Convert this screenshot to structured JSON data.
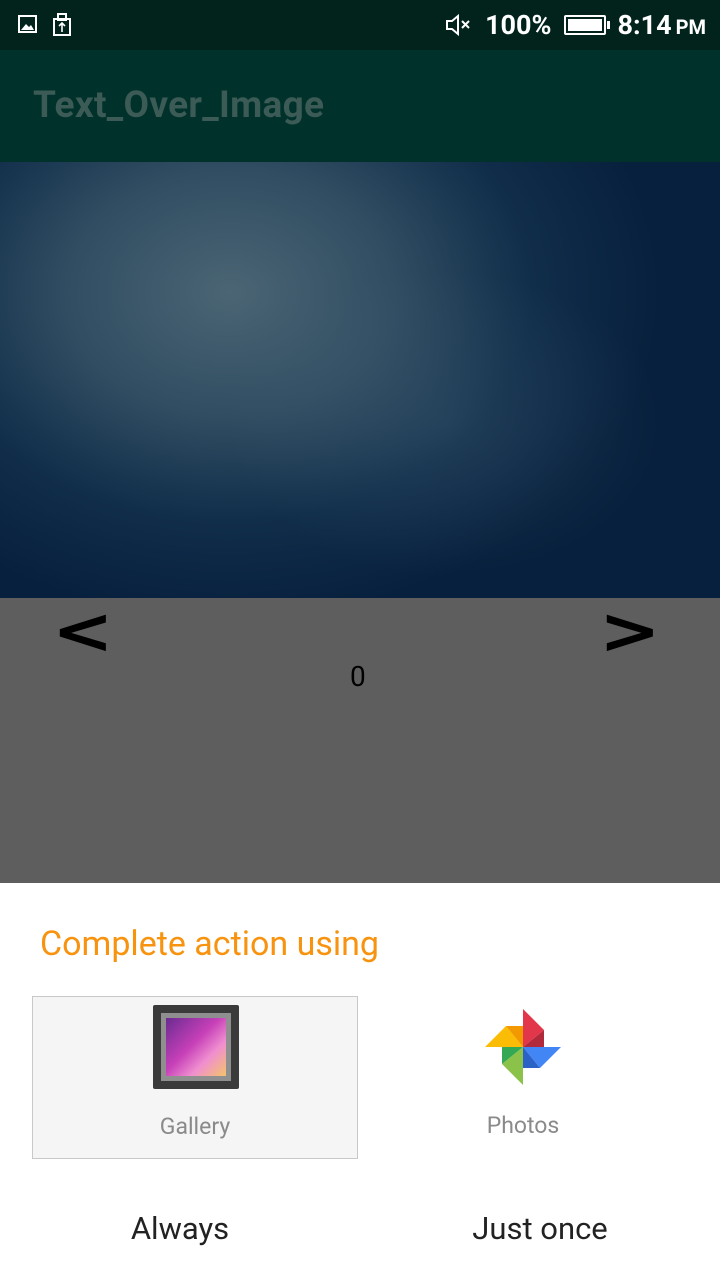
{
  "status_bar": {
    "left_icons": [
      "image-icon",
      "usb-icon"
    ],
    "mute_icon": "mute-icon",
    "battery_percent": "100%",
    "time": "8:14",
    "time_suffix": "PM"
  },
  "app_bar": {
    "title": "Text_Over_Image"
  },
  "viewer": {
    "prev_symbol": "<",
    "next_symbol": ">",
    "counter": "0"
  },
  "chooser": {
    "title": "Complete action using",
    "options": [
      {
        "label": "Gallery",
        "icon": "gallery-icon"
      },
      {
        "label": "Photos",
        "icon": "photos-icon"
      }
    ],
    "always_label": "Always",
    "once_label": "Just once"
  },
  "colors": {
    "status_bar": "#01231c",
    "app_bar": "#00322b",
    "accent": "#f7930f"
  }
}
